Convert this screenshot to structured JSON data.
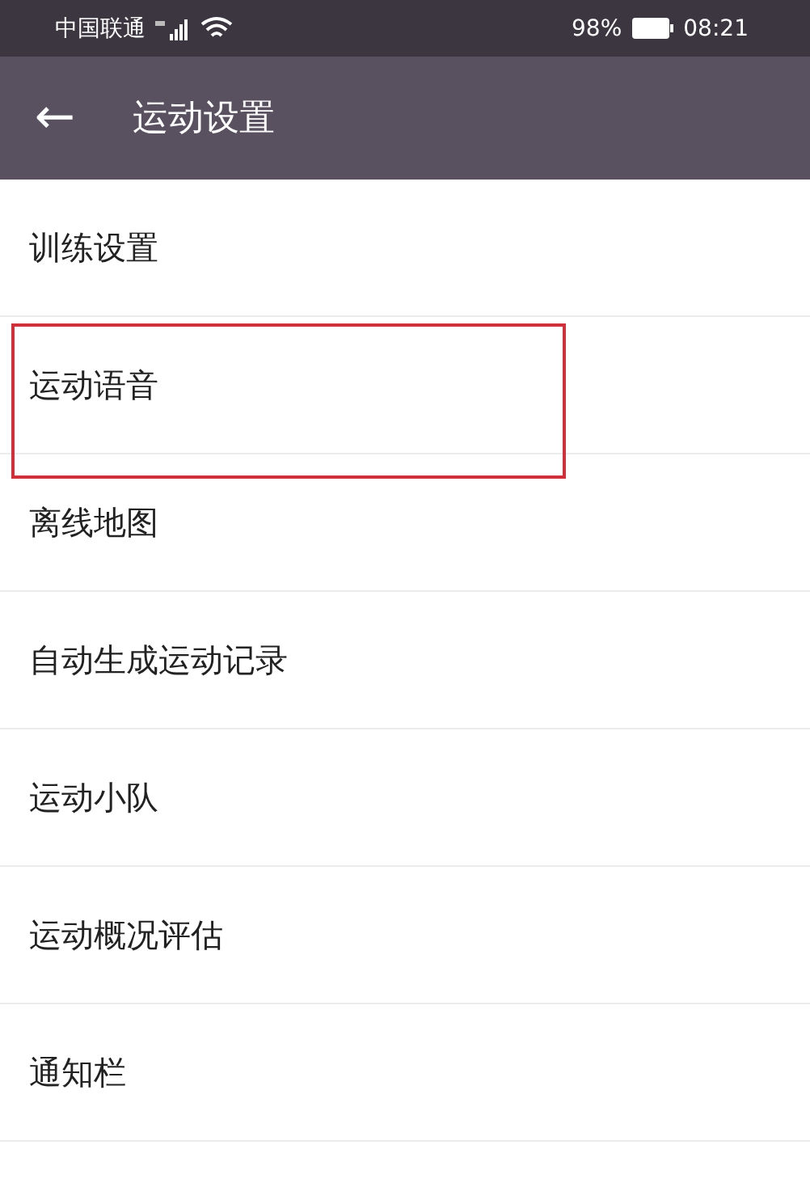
{
  "status_bar": {
    "carrier": "中国联通",
    "battery": "98%",
    "time": "08:21"
  },
  "header": {
    "back": "←",
    "title": "运动设置"
  },
  "items": [
    {
      "label": "训练设置",
      "highlighted": false
    },
    {
      "label": "运动语音",
      "highlighted": true
    },
    {
      "label": "离线地图",
      "highlighted": false
    },
    {
      "label": "自动生成运动记录",
      "highlighted": false
    },
    {
      "label": "运动小队",
      "highlighted": false
    },
    {
      "label": "运动概况评估",
      "highlighted": false
    },
    {
      "label": "通知栏",
      "highlighted": false
    }
  ]
}
